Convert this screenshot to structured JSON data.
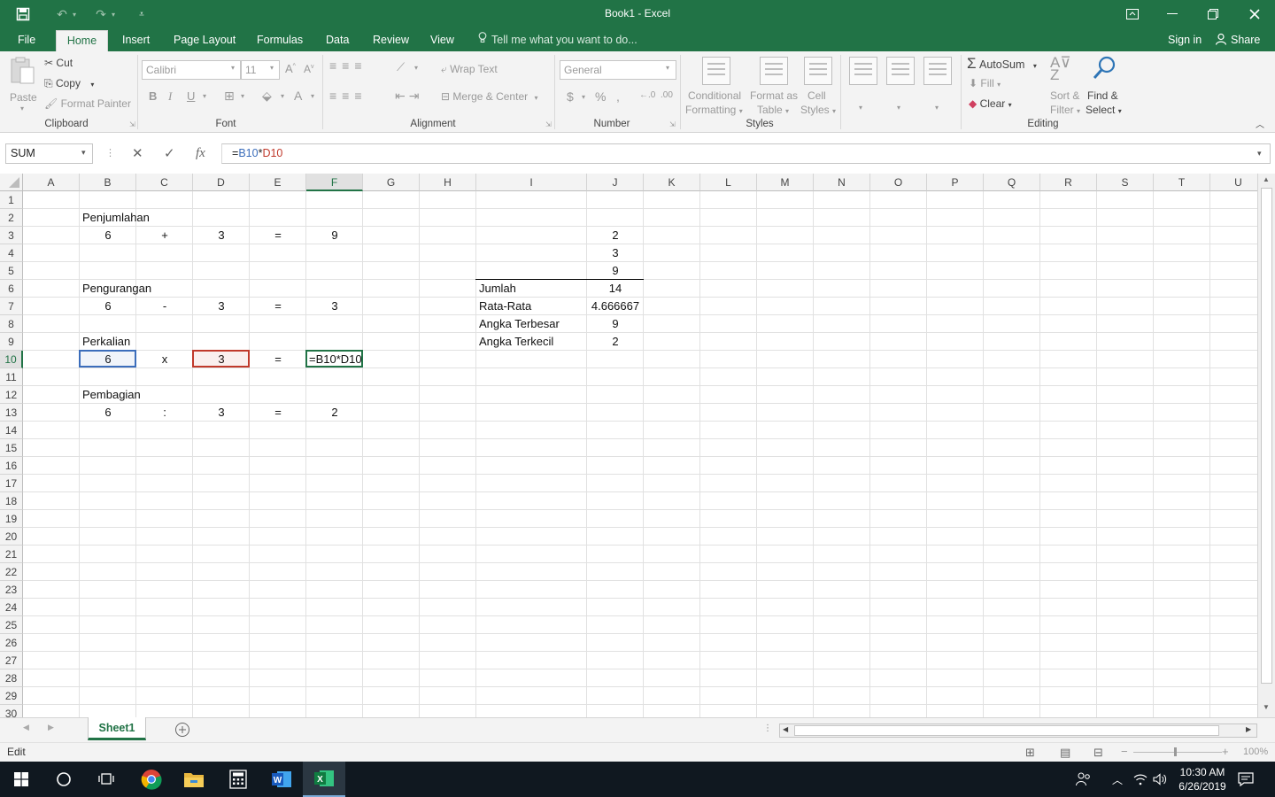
{
  "window": {
    "title": "Book1  -  Excel"
  },
  "ribbon_tabs": [
    "File",
    "Home",
    "Insert",
    "Page Layout",
    "Formulas",
    "Data",
    "Review",
    "View"
  ],
  "active_tab": "Home",
  "tell_me": "Tell me what you want to do...",
  "account": {
    "signin": "Sign in",
    "share": "Share"
  },
  "clipboard": {
    "paste": "Paste",
    "cut": "Cut",
    "copy": "Copy",
    "format_painter": "Format Painter",
    "label": "Clipboard"
  },
  "font": {
    "name": "Calibri",
    "size": "11",
    "label": "Font"
  },
  "alignment": {
    "wrap": "Wrap Text",
    "merge": "Merge & Center",
    "label": "Alignment"
  },
  "number": {
    "format": "General",
    "label": "Number"
  },
  "styles": {
    "conditional": "Conditional",
    "conditional2": "Formatting",
    "format_as": "Format as",
    "format_as2": "Table",
    "cell": "Cell",
    "cell2": "Styles",
    "label": "Styles"
  },
  "cells": {
    "B2": "Penjumlahan",
    "B3": "6",
    "C3": "+",
    "D3": "3",
    "E3": "=",
    "F3": "9",
    "B6": "Pengurangan",
    "B7": "6",
    "C7": "-",
    "D7": "3",
    "E7": "=",
    "F7": "3",
    "B9": "Perkalian",
    "B10": "6",
    "C10": "x",
    "D10": "3",
    "E10": "=",
    "F10": "=B10*D10",
    "B12": "Pembagian",
    "B13": "6",
    "C13": ":",
    "D13": "3",
    "E13": "=",
    "F13": "2",
    "J3": "2",
    "J4": "3",
    "J5": "9",
    "I6": "Jumlah",
    "J6": "14",
    "I7": "Rata-Rata",
    "J7": "4.666667",
    "I8": "Angka Terbesar",
    "J8": "9",
    "I9": "Angka Terkecil",
    "J9": "2"
  },
  "editing": {
    "autosum": "AutoSum",
    "fill": "Fill",
    "clear": "Clear",
    "sort": "Sort &",
    "sort2": "Filter",
    "find": "Find &",
    "find2": "Select",
    "label": "Editing"
  },
  "formula_bar": {
    "name_box": "SUM",
    "formula_prefix": "=",
    "ref1": "B10",
    "op": "*",
    "ref2": "D10"
  },
  "columns": [
    "A",
    "B",
    "C",
    "D",
    "E",
    "F",
    "G",
    "H",
    "I",
    "J",
    "K",
    "L",
    "M",
    "N",
    "O",
    "P",
    "Q",
    "R",
    "S",
    "T",
    "U"
  ],
  "rows": [
    "1",
    "2",
    "3",
    "4",
    "5",
    "6",
    "7",
    "8",
    "9",
    "10",
    "11",
    "12",
    "13",
    "14",
    "15",
    "16",
    "17",
    "18",
    "19",
    "20",
    "21",
    "22",
    "23",
    "24",
    "25",
    "26",
    "27",
    "28",
    "29",
    "30"
  ],
  "sheet_tab": "Sheet1",
  "status": {
    "mode": "Edit",
    "zoom": "100%"
  },
  "clock": {
    "time": "10:30 AM",
    "date": "6/26/2019"
  },
  "colors": {
    "excel_green": "#217346",
    "ref1": "#3b6dbb",
    "ref2": "#c0392b"
  }
}
